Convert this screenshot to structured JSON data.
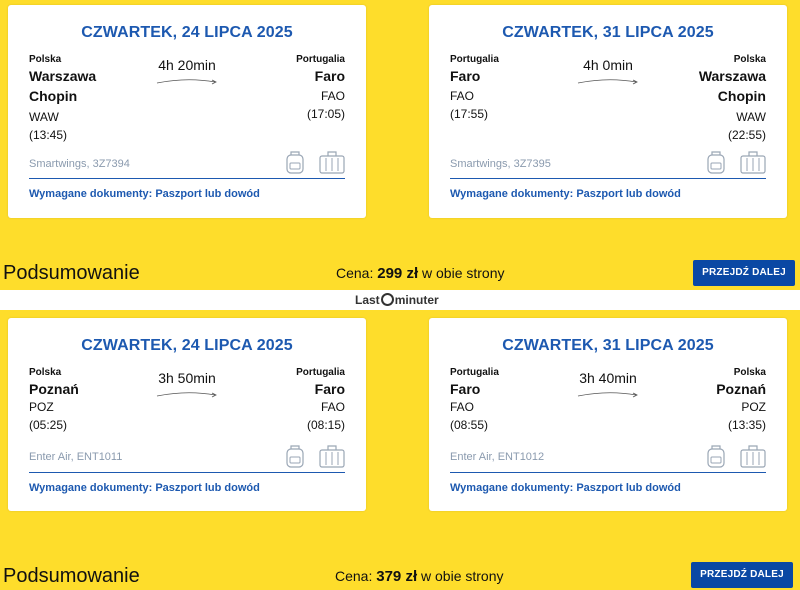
{
  "colors": {
    "background": "#fedd2b",
    "accent_blue": "#1d59b0",
    "button": "#0a48a4"
  },
  "offers": [
    {
      "outbound": {
        "date": "CZWARTEK, 24 LIPCA 2025",
        "from": {
          "country": "Polska",
          "city_line1": "Warszawa",
          "city_line2": "Chopin",
          "code": "WAW",
          "time": "(13:45)"
        },
        "to": {
          "country": "Portugalia",
          "city_line1": "Faro",
          "city_line2": "",
          "code": "FAO",
          "time": "(17:05)"
        },
        "duration": "4h 20min",
        "flight": "Smartwings, 3Z7394",
        "documents": "Wymagane dokumenty: Paszport lub dowód"
      },
      "inbound": {
        "date": "CZWARTEK, 31 LIPCA 2025",
        "from": {
          "country": "Portugalia",
          "city_line1": "Faro",
          "city_line2": "",
          "code": "FAO",
          "time": "(17:55)"
        },
        "to": {
          "country": "Polska",
          "city_line1": "Warszawa",
          "city_line2": "Chopin",
          "code": "WAW",
          "time": "(22:55)"
        },
        "duration": "4h 0min",
        "flight": "Smartwings, 3Z7395",
        "documents": "Wymagane dokumenty: Paszport lub dowód"
      },
      "summary": {
        "title": "Podsumowanie",
        "price_label": "Cena:",
        "price": "299 zł",
        "price_suffix": "w obie strony",
        "button": "PRZEJDŹ DALEJ"
      }
    },
    {
      "outbound": {
        "date": "CZWARTEK, 24 LIPCA 2025",
        "from": {
          "country": "Polska",
          "city_line1": "Poznań",
          "city_line2": "",
          "code": "POZ",
          "time": "(05:25)"
        },
        "to": {
          "country": "Portugalia",
          "city_line1": "Faro",
          "city_line2": "",
          "code": "FAO",
          "time": "(08:15)"
        },
        "duration": "3h 50min",
        "flight": "Enter Air, ENT1011",
        "documents": "Wymagane dokumenty: Paszport lub dowód"
      },
      "inbound": {
        "date": "CZWARTEK, 31 LIPCA 2025",
        "from": {
          "country": "Portugalia",
          "city_line1": "Faro",
          "city_line2": "",
          "code": "FAO",
          "time": "(08:55)"
        },
        "to": {
          "country": "Polska",
          "city_line1": "Poznań",
          "city_line2": "",
          "code": "POZ",
          "time": "(13:35)"
        },
        "duration": "3h 40min",
        "flight": "Enter Air, ENT1012",
        "documents": "Wymagane dokumenty: Paszport lub dowód"
      },
      "summary": {
        "title": "Podsumowanie",
        "price_label": "Cena:",
        "price": "379 zł",
        "price_suffix": "w obie strony",
        "button": "PRZEJDŹ DALEJ"
      }
    }
  ],
  "logo": {
    "part1": "Last",
    "part2": "minuter"
  }
}
